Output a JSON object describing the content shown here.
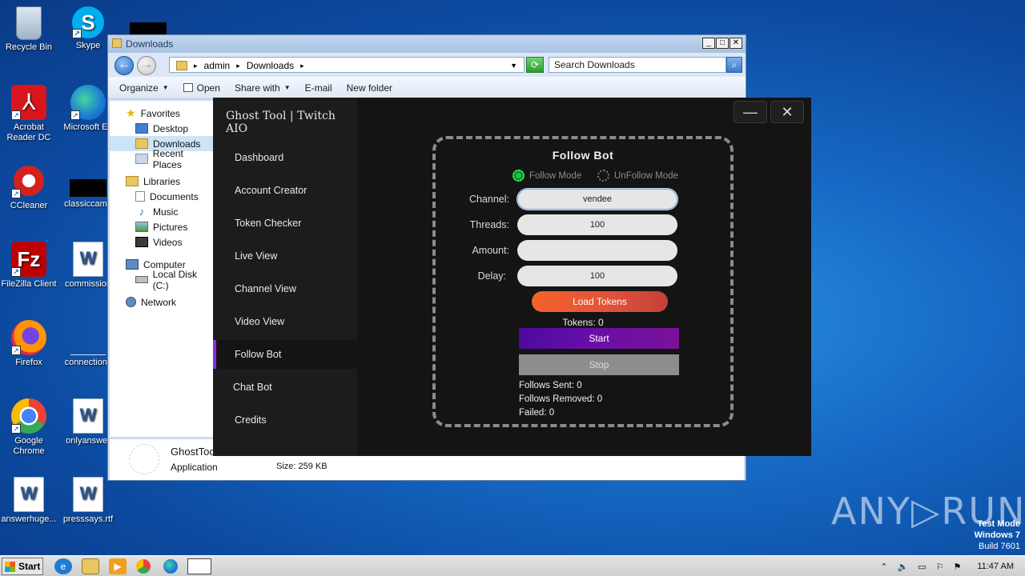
{
  "desktop": {
    "icons": [
      {
        "label": "Recycle Bin"
      },
      {
        "label": "Skype"
      },
      {
        "label": "Acrobat Reader DC"
      },
      {
        "label": "Microsoft Ed"
      },
      {
        "label": "CCleaner"
      },
      {
        "label": "classiccame"
      },
      {
        "label": "FileZilla Client"
      },
      {
        "label": "commission"
      },
      {
        "label": "Firefox"
      },
      {
        "label": "connectionc"
      },
      {
        "label": "Google Chrome"
      },
      {
        "label": "onlyanswer"
      },
      {
        "label": "answerhuge..."
      },
      {
        "label": "presssays.rtf"
      }
    ]
  },
  "explorer": {
    "title": "Downloads",
    "address": {
      "segments": [
        "admin",
        "Downloads"
      ]
    },
    "search_placeholder": "Search Downloads",
    "toolbar": {
      "organize": "Organize",
      "open": "Open",
      "share": "Share with",
      "email": "E-mail",
      "new_folder": "New folder"
    },
    "nav": {
      "favorites": "Favorites",
      "desktop": "Desktop",
      "downloads": "Downloads",
      "recent": "Recent Places",
      "libraries": "Libraries",
      "documents": "Documents",
      "music": "Music",
      "pictures": "Pictures",
      "videos": "Videos",
      "computer": "Computer",
      "local_disk": "Local Disk (C:)",
      "network": "Network"
    },
    "details": {
      "name": "GhostToo",
      "type": "Application",
      "size": "Size: 259 KB"
    }
  },
  "app": {
    "title": "Ghost Tool | Twitch AIO",
    "sidebar": [
      {
        "label": "Dashboard"
      },
      {
        "label": "Account Creator"
      },
      {
        "label": "Token Checker"
      },
      {
        "label": "Live View"
      },
      {
        "label": "Channel View"
      },
      {
        "label": "Video View"
      },
      {
        "label": "Follow Bot"
      },
      {
        "label": "Chat Bot"
      },
      {
        "label": "Credits"
      }
    ],
    "minimize": "—",
    "close": "✕",
    "panel": {
      "title": "Follow Bot",
      "mode_follow": "Follow Mode",
      "mode_unfollow": "UnFollow Mode",
      "channel_label": "Channel:",
      "channel_value": "vendee",
      "threads_label": "Threads:",
      "threads_value": "100",
      "amount_label": "Amount:",
      "amount_value": "",
      "delay_label": "Delay:",
      "delay_value": "100",
      "load_tokens": "Load Tokens",
      "tokens": "Tokens: 0",
      "start": "Start",
      "stop": "Stop",
      "follows_sent": "Follows Sent: 0",
      "follows_removed": "Follows Removed: 0",
      "failed": "Failed: 0"
    }
  },
  "watermark": {
    "brand": "ANY▷RUN",
    "mode": "Test Mode",
    "os": "Windows 7",
    "build": "Build 7601"
  },
  "taskbar": {
    "start": "Start",
    "time": "11:47 AM"
  }
}
